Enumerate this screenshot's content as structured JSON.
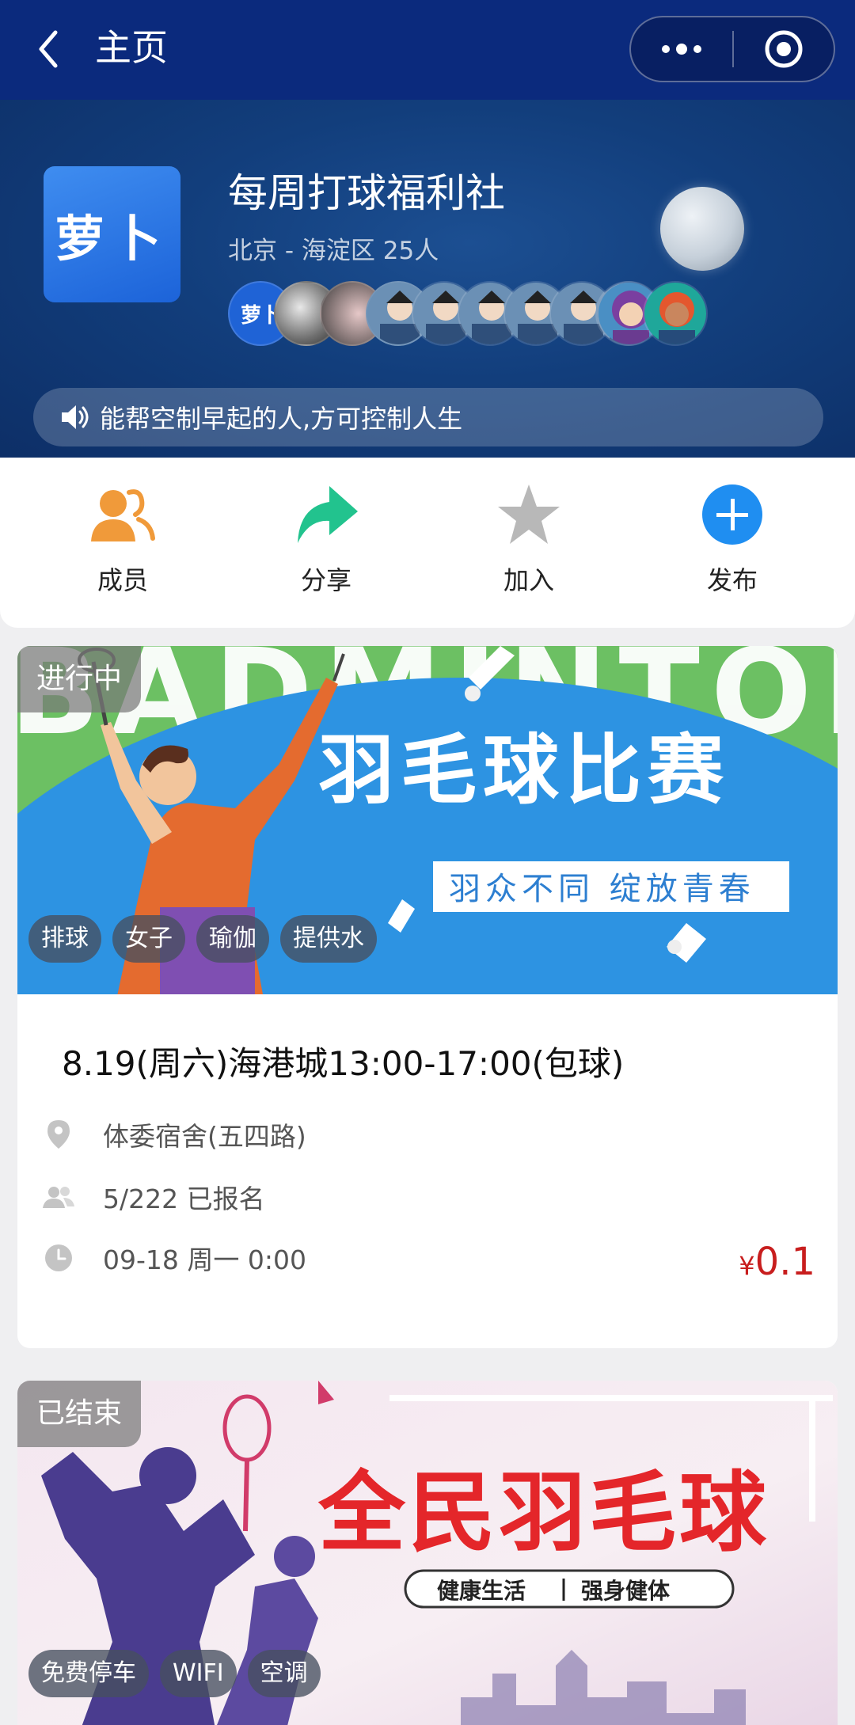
{
  "navbar": {
    "title": "主页",
    "bg": "#0b2a7d"
  },
  "club": {
    "logo_text": "萝卜",
    "name": "每周打球福利社",
    "meta": "北京 - 海淀区 25人",
    "avatar_count": 11,
    "first_avatar_text": "萝卜",
    "notice": "能帮空制早起的人,方可控制人生"
  },
  "actions": [
    {
      "label": "成员",
      "icon": "members-icon",
      "color": "#f09a3a"
    },
    {
      "label": "分享",
      "icon": "share-arrow-icon",
      "color": "#22c38e"
    },
    {
      "label": "加入",
      "icon": "star-icon",
      "color": "#b8b8b8"
    },
    {
      "label": "发布",
      "icon": "plus-circle-icon",
      "color": "#1f8ef1"
    }
  ],
  "events": [
    {
      "status": "进行中",
      "banner": {
        "bg_text": "BADMINTON",
        "title": "羽毛球比赛",
        "subtitle": "羽众不同 绽放青春"
      },
      "tags": [
        "排球",
        "女子",
        "瑜伽",
        "提供水"
      ],
      "title": "8.19(周六)海港城13:00-17:00(包球)",
      "location": "体委宿舍(五四路)",
      "signup": "5/222 已报名",
      "time": "09-18 周一 0:00",
      "price_symbol": "¥",
      "price": "0.1"
    },
    {
      "status": "已结束",
      "banner": {
        "title": "全民羽毛球",
        "subtitle_left": "健康生活",
        "subtitle_right": "强身健体"
      },
      "tags": [
        "免费停车",
        "WIFI",
        "空调"
      ]
    }
  ],
  "colors": {
    "price": "#c81e1e",
    "header_blue": "#123e7c",
    "banner_green": "#6cc063",
    "banner_blue": "#2d93e2"
  }
}
